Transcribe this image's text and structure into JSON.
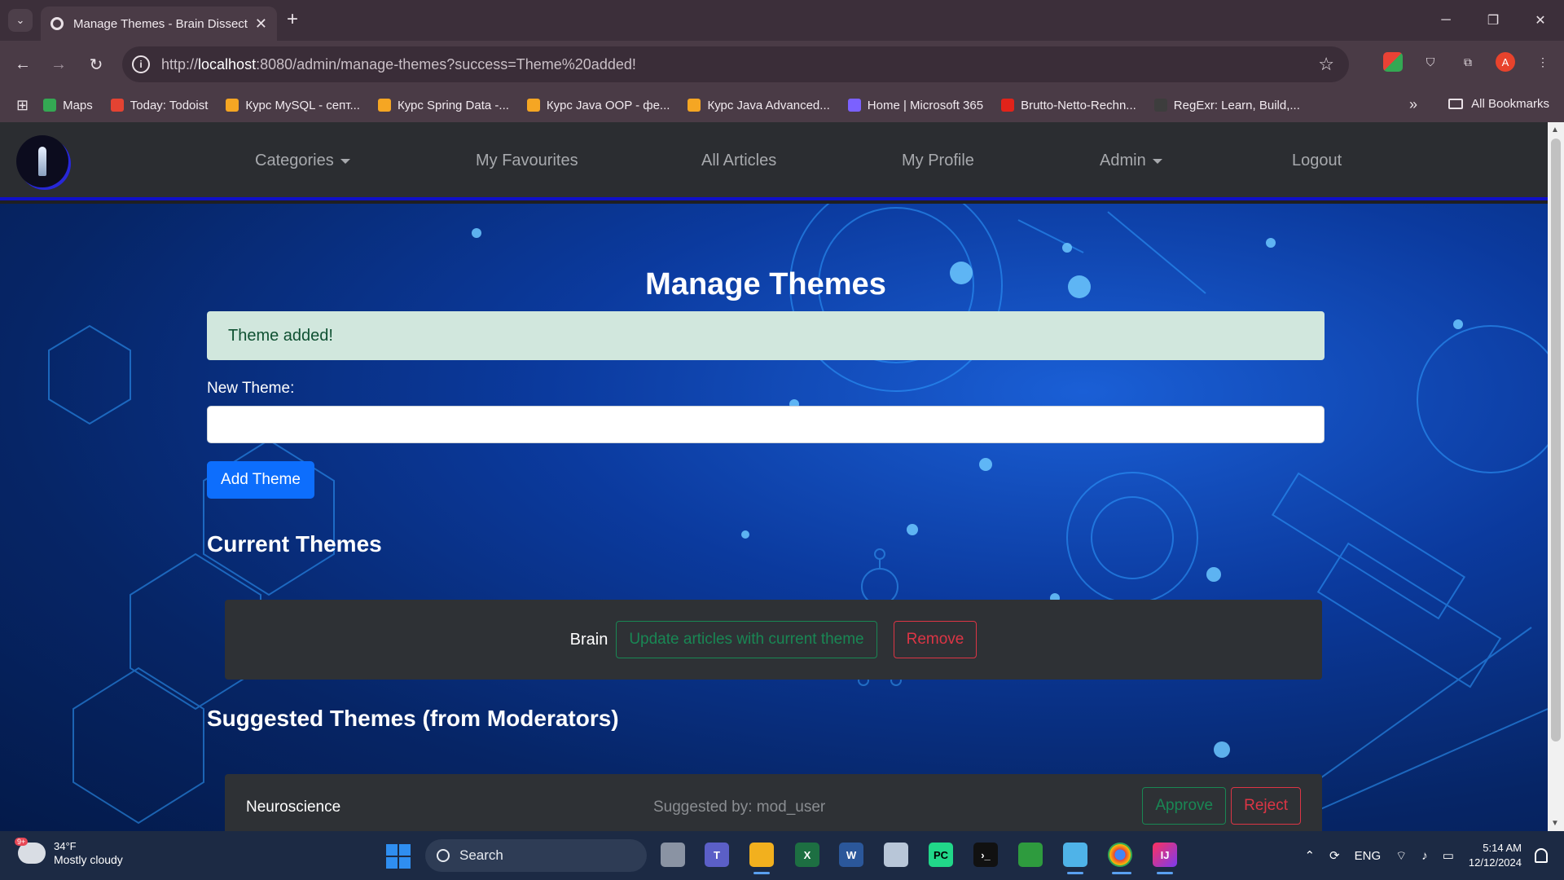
{
  "browser": {
    "tab_title": "Manage Themes - Brain Dissect",
    "url_host": "localhost",
    "url_prefix": "http://",
    "url_rest": ":8080/admin/manage-themes?success=Theme%20added!",
    "bookmarks": [
      {
        "label": "Maps",
        "color": "#34a853"
      },
      {
        "label": "Today: Todoist",
        "color": "#e44332"
      },
      {
        "label": "Курс MySQL - септ...",
        "color": "#f5a623"
      },
      {
        "label": "Курс Spring Data -...",
        "color": "#f5a623"
      },
      {
        "label": "Курс Java OOP - фе...",
        "color": "#f5a623"
      },
      {
        "label": "Курс Java Advanced...",
        "color": "#f5a623"
      },
      {
        "label": "Home | Microsoft 365",
        "color": "#7b61ff"
      },
      {
        "label": "Brutto-Netto-Rechn...",
        "color": "#e2231a"
      },
      {
        "label": "RegExr: Learn, Build,...",
        "color": "#3d3d3d"
      }
    ],
    "all_bookmarks": "All Bookmarks",
    "profile_initial": "A"
  },
  "site_nav": {
    "items": [
      "Categories",
      "My Favourites",
      "All Articles",
      "My Profile",
      "Admin",
      "Logout"
    ]
  },
  "page": {
    "title": "Manage Themes",
    "alert": "Theme added!",
    "new_theme_label": "New Theme:",
    "new_theme_value": "",
    "add_button": "Add Theme",
    "current_themes_title": "Current Themes",
    "current_themes": [
      {
        "name": "Brain",
        "update_label": "Update articles with current theme",
        "remove_label": "Remove"
      }
    ],
    "suggested_title": "Suggested Themes (from Moderators)",
    "suggested": [
      {
        "name": "Neuroscience",
        "suggested_by": "Suggested by: mod_user",
        "approve_label": "Approve",
        "reject_label": "Reject"
      }
    ]
  },
  "taskbar": {
    "weather_badge": "9+",
    "temperature": "34°F",
    "weather_desc": "Mostly cloudy",
    "search_label": "Search",
    "language": "ENG",
    "time": "5:14 AM",
    "date": "12/12/2024"
  },
  "colors": {
    "primary": "#0d6efd",
    "success": "#198754",
    "danger": "#dc3545",
    "alert_bg": "#d1e7dd",
    "nav_border": "#1010c8"
  }
}
